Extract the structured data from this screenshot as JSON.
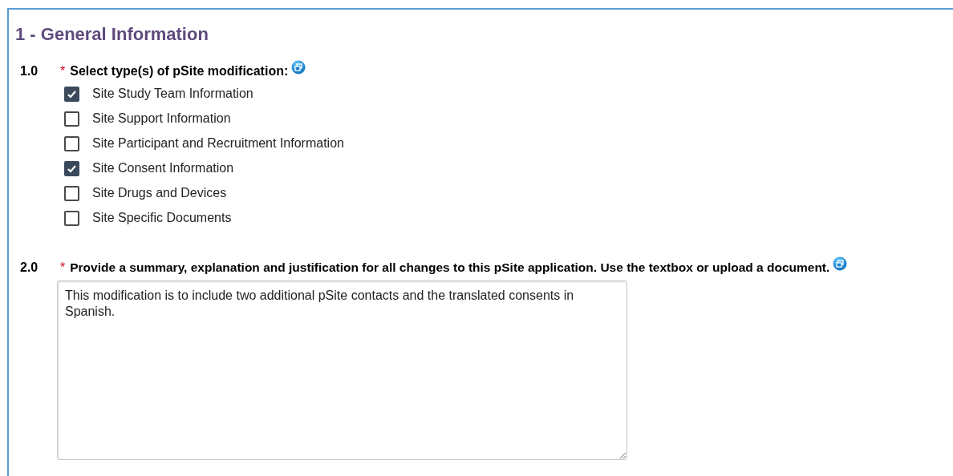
{
  "section_title": "1 - General Information",
  "questions": [
    {
      "number": "1.0",
      "required_mark": "*",
      "label": "Select type(s) of pSite modification:",
      "kind": "checkboxes",
      "options": [
        {
          "label": "Site Study Team Information",
          "checked": true
        },
        {
          "label": "Site Support Information",
          "checked": false
        },
        {
          "label": "Site Participant and Recruitment Information",
          "checked": false
        },
        {
          "label": "Site Consent Information",
          "checked": true
        },
        {
          "label": "Site Drugs and Devices",
          "checked": false
        },
        {
          "label": "Site Specific Documents",
          "checked": false
        }
      ]
    },
    {
      "number": "2.0",
      "required_mark": "*",
      "label": "Provide a summary, explanation and justification for all changes to this pSite application. Use the textbox or upload a document.",
      "kind": "textarea",
      "value": "This modification is to include two additional pSite contacts and the translated consents in Spanish."
    }
  ]
}
